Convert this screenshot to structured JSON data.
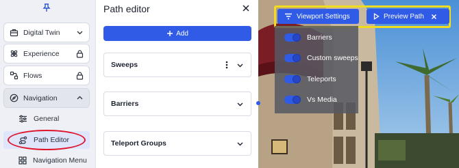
{
  "sidebar": {
    "items": [
      {
        "label": "Digital Twin",
        "icon": "briefcase-icon",
        "trailing": "chevron-down-icon"
      },
      {
        "label": "Experience",
        "icon": "atom-icon",
        "trailing": "lock-icon"
      },
      {
        "label": "Flows",
        "icon": "route-icon",
        "trailing": "lock-icon"
      },
      {
        "label": "Navigation",
        "icon": "compass-icon",
        "trailing": "chevron-up-icon"
      }
    ],
    "sub_items": [
      {
        "label": "General",
        "icon": "sliders-icon"
      },
      {
        "label": "Path Editor",
        "icon": "path-icon"
      },
      {
        "label": "Navigation Menu",
        "icon": "grid-icon"
      }
    ]
  },
  "panel": {
    "title": "Path editor",
    "add_label": "Add",
    "sections": [
      {
        "label": "Sweeps"
      },
      {
        "label": "Barriers"
      },
      {
        "label": "Teleport Groups"
      }
    ]
  },
  "toolbar": {
    "viewport_label": "Viewport Settings",
    "preview_label": "Preview Path"
  },
  "viewport_settings": {
    "toggles": [
      {
        "label": "Barriers",
        "on": true
      },
      {
        "label": "Custom sweeps",
        "on": true
      },
      {
        "label": "Teleports",
        "on": true
      },
      {
        "label": "Vs Media",
        "on": true
      }
    ]
  },
  "colors": {
    "accent": "#2f5be6",
    "highlight_outline": "#f1dd1e",
    "annotation_circle": "#e0132b"
  }
}
